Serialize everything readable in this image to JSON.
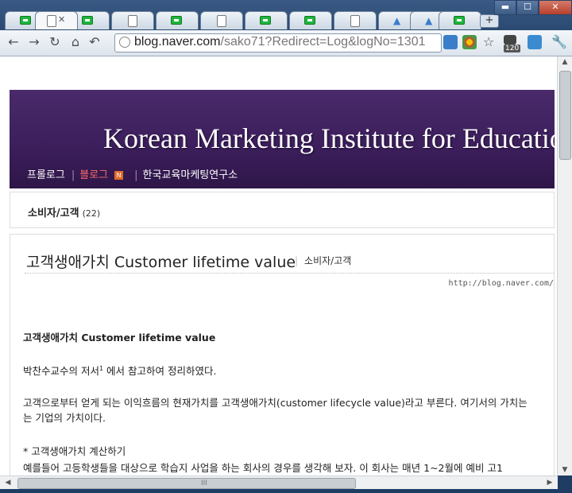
{
  "browser": {
    "tabs": [
      "",
      "",
      "",
      "",
      "",
      "",
      "",
      "",
      "",
      "",
      "",
      ""
    ],
    "tab_icons": [
      "green-icon",
      "page-icon",
      "green-icon",
      "green-icon",
      "page-icon",
      "green-icon",
      "page-icon",
      "green-icon",
      "page-icon",
      "peak-icon",
      "peak-icon",
      "green-icon",
      "green-icon"
    ],
    "new_tab_label": "+",
    "window_buttons": {
      "minimize": "▬",
      "maximize": "☐",
      "close": "✕"
    },
    "url_host": "blog.naver.com",
    "url_rest": "/sako71?Redirect=Log&logNo=1301",
    "extension_badge": "120"
  },
  "blog": {
    "banner_title": "Korean Marketing Institute for Education",
    "menu": {
      "prologue": "프롤로그",
      "blog": "블로그",
      "new_badge": "N",
      "institute": "한국교육마케팅연구소"
    },
    "category": {
      "name": "소비자/고객",
      "count": "(22)"
    }
  },
  "post": {
    "title": "고객생애가치 Customer lifetime value",
    "category": "소비자/고객",
    "source_url": "http://blog.naver.com/",
    "heading": "고객생애가치 Customer lifetime value",
    "para1_pre": "박찬수교수의 저서",
    "para1_sup": "1",
    "para1_post": " 에서 참고하여 정리하였다.",
    "para2_line1": "고객으로부터 얻게 되는 이익흐름의 현재가치를 고객생애가치(customer lifecycle value)라고 부른다. 여기서의 가치는",
    "para2_line2": "는 기업의 가치이다.",
    "bullet": "* 고객생애가치 계산하기",
    "para3": "예를들어 고등학생들을 대상으로 학습지 사업을 하는 회사의 경우를 생각해 보자. 이 회사는 매년 1~2월에 예비 고1"
  }
}
